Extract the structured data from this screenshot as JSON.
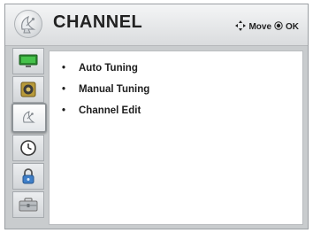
{
  "header": {
    "title": "CHANNEL",
    "hint_move": "Move",
    "hint_ok": "OK",
    "icon": "satellite-dish-icon"
  },
  "sidebar": {
    "items": [
      {
        "icon": "picture-tv-icon",
        "selected": false
      },
      {
        "icon": "speaker-audio-icon",
        "selected": false
      },
      {
        "icon": "satellite-dish-icon",
        "selected": true
      },
      {
        "icon": "clock-time-icon",
        "selected": false
      },
      {
        "icon": "lock-icon",
        "selected": false
      },
      {
        "icon": "toolbox-option-icon",
        "selected": false
      }
    ]
  },
  "menu": {
    "bullet": "•",
    "items": [
      {
        "label": "Auto Tuning"
      },
      {
        "label": "Manual Tuning"
      },
      {
        "label": "Channel Edit"
      }
    ]
  },
  "colors": {
    "frame": "#c9ccce",
    "panel": "#ffffff",
    "text": "#1d1d1d"
  }
}
